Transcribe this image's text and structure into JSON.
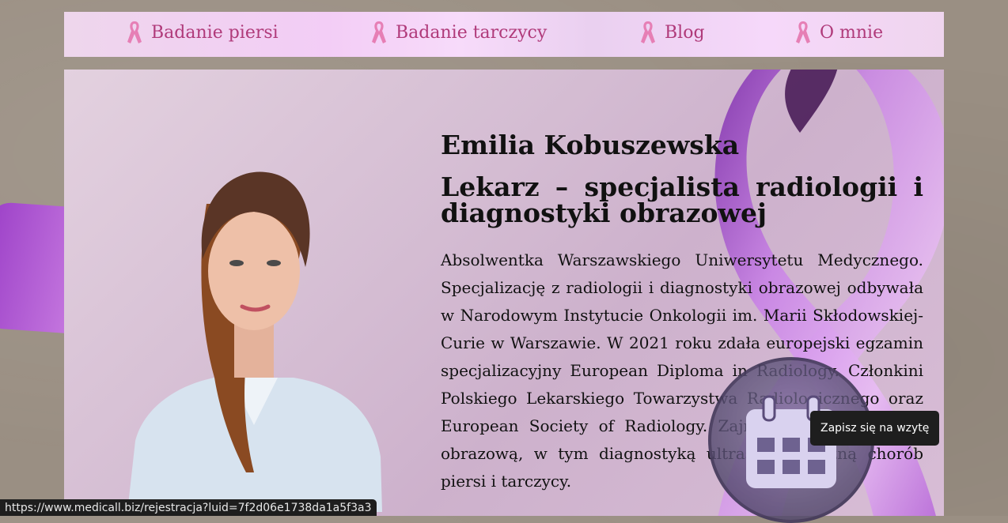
{
  "nav": {
    "items": [
      {
        "label": "Badanie piersi"
      },
      {
        "label": "Badanie tarczycy"
      },
      {
        "label": "Blog"
      },
      {
        "label": "O mnie"
      }
    ]
  },
  "profile": {
    "name": "Emilia Kobuszewska",
    "title": "Lekarz – specjalista radiologii i diagnostyki obrazowej",
    "bio": "Absolwentka Warszawskiego Uniwersytetu Medycznego. Specjalizację z radiologii i diagnostyki obrazowej odbywała w Narodowym Instytucie Onkologii im. Marii Skłodowskiej-Curie w Warszawie. W 2021 roku zdała europejski egzamin specjalizacyjny European Diploma in Radiology. Członkini Polskiego Lekarskiego Towarzystwa Radiologicznego oraz European Society of Radiology. Zajmuje się diagnostyką obrazową, w tym diagnostyką ultrasonograficzną chorób piersi i tarczycy."
  },
  "calendar_button": {
    "icon": "calendar-icon",
    "tooltip": "Zapisz się na wzytę"
  },
  "status_bar": {
    "url": "https://www.medicall.biz/rejestracja?luid=7f2d06e1738da1a5f3a3"
  },
  "colors": {
    "nav_text": "#b03a7a",
    "ribbon": "#e67fb5",
    "accent_purple": "#b85ad6"
  }
}
